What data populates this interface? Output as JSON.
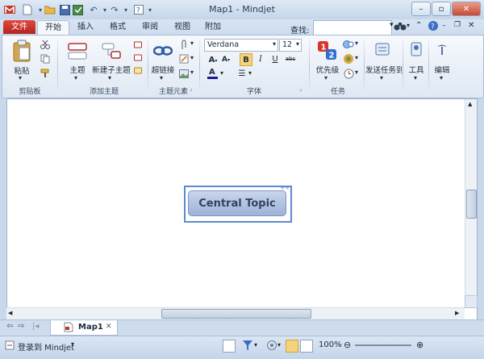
{
  "app": {
    "title": "Map1 - Mindjet",
    "accent": "#c0392b",
    "ribbon_bg": "#e9eff7"
  },
  "tabs": [
    "文件",
    "开始",
    "插入",
    "格式",
    "审阅",
    "视图",
    "附加"
  ],
  "find": {
    "label": "查找:",
    "value": ""
  },
  "ribbon": {
    "clipboard": {
      "paste": "粘贴",
      "group": "剪贴板"
    },
    "add_topic": {
      "topic": "主题",
      "subtopic": "新建子主题",
      "group": "添加主题"
    },
    "topic_elements": {
      "hyperlink": "超链接",
      "group": "主题元素"
    },
    "font": {
      "family": "Verdana",
      "size": "12",
      "group": "字体"
    },
    "tasks": {
      "priority": "优先级",
      "group": "任务"
    },
    "send": {
      "label": "发送任务到"
    },
    "tools": {
      "label": "工具"
    },
    "edit": {
      "label": "编辑"
    }
  },
  "map": {
    "central_topic": "Central Topic"
  },
  "doc_tabs": [
    {
      "label": "Map1"
    }
  ],
  "status": {
    "login": "登录到 Mindjet",
    "zoom": "100%"
  },
  "icons": [
    "app-logo-icon",
    "new-icon",
    "open-icon",
    "save-icon",
    "undo-icon",
    "redo-icon",
    "help-icon",
    "paste-icon",
    "cut-icon",
    "copy-icon",
    "format-painter-icon",
    "topic-icon",
    "subtopic-icon",
    "hyperlink-icon",
    "attachment-icon",
    "priority-icon",
    "send-task-icon",
    "tools-icon",
    "edit-icon",
    "filter-icon",
    "zoom-icon"
  ]
}
